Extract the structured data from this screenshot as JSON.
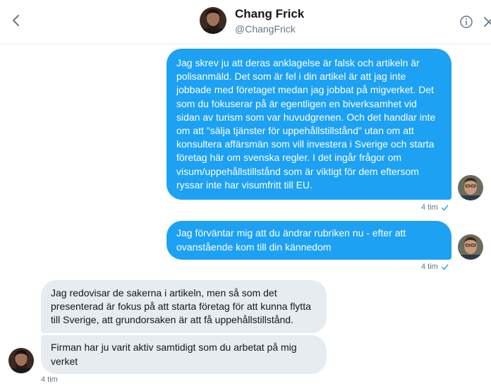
{
  "header": {
    "name": "Chang Frick",
    "handle": "@ChangFrick"
  },
  "messages": [
    {
      "text": "Jag skrev ju att deras anklagelse är falsk och artikeln är polisanmäld. Det som är fel i din artikel är att jag inte jobbade med företaget medan jag jobbat på migverket. Det som du fokuserar på är egentligen en biverksamhet vid sidan av turism som var huvudgrenen. Och det handlar inte om att \"sälja tjänster för uppehållstillstånd\" utan om att konsultera affärsmän som vill investera i Sverige och starta företag här om svenska regler. I det ingår frågor om visum/uppehållstillstånd som är viktigt för dem eftersom ryssar inte har visumfritt till EU.",
      "time": "4 tim"
    },
    {
      "text": "Jag förväntar mig att du ändrar rubriken nu - efter att ovanstående kom till din kännedom",
      "time": "4 tim"
    },
    {
      "text": "Jag redovisar de sakerna i artikeln, men så som det presenterad är fokus på att starta företag för att kunna flytta till Sverige, att grundorsaken är att få uppehållstillstånd."
    },
    {
      "text": "Firman har ju varit aktiv samtidigt som du arbetat på mig verket",
      "time": "4 tim"
    }
  ],
  "colors": {
    "sent_bubble": "#1da1f2",
    "received_bubble": "#e6ecf0",
    "meta_text": "#657786",
    "check": "#1da1f2"
  },
  "icons": {
    "back": "chevron-left-icon",
    "info": "info-icon",
    "close": "close-icon",
    "read": "checkmark-icon"
  }
}
